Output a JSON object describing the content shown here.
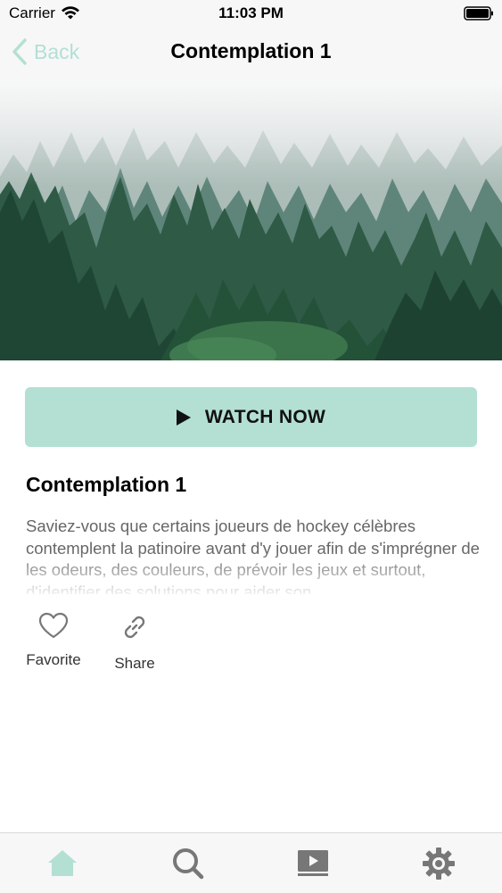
{
  "status_bar": {
    "carrier": "Carrier",
    "time": "11:03 PM"
  },
  "nav": {
    "back_label": "Back",
    "title": "Contemplation 1"
  },
  "hero": {
    "image": "misty pine forest"
  },
  "watch_button": {
    "label": "WATCH NOW",
    "icon": "play-icon"
  },
  "content": {
    "title": "Contemplation 1",
    "description": "Saviez-vous que certains joueurs de hockey célèbres contemplent la patinoire avant d'y jouer afin de s'imprégner de les odeurs, des couleurs, de prévoir les jeux et surtout, d'identifier des solutions pour aider son"
  },
  "actions": [
    {
      "label": "Favorite",
      "icon": "heart-icon"
    },
    {
      "label": "Share",
      "icon": "link-icon"
    }
  ],
  "tab_bar": {
    "tabs": [
      {
        "icon": "home-icon",
        "active": true
      },
      {
        "icon": "search-icon",
        "active": false
      },
      {
        "icon": "video-icon",
        "active": false
      },
      {
        "icon": "gear-icon",
        "active": false
      }
    ]
  },
  "colors": {
    "accent": "#b3e0d3",
    "tab_inactive": "#777777",
    "text_secondary": "#666666"
  }
}
